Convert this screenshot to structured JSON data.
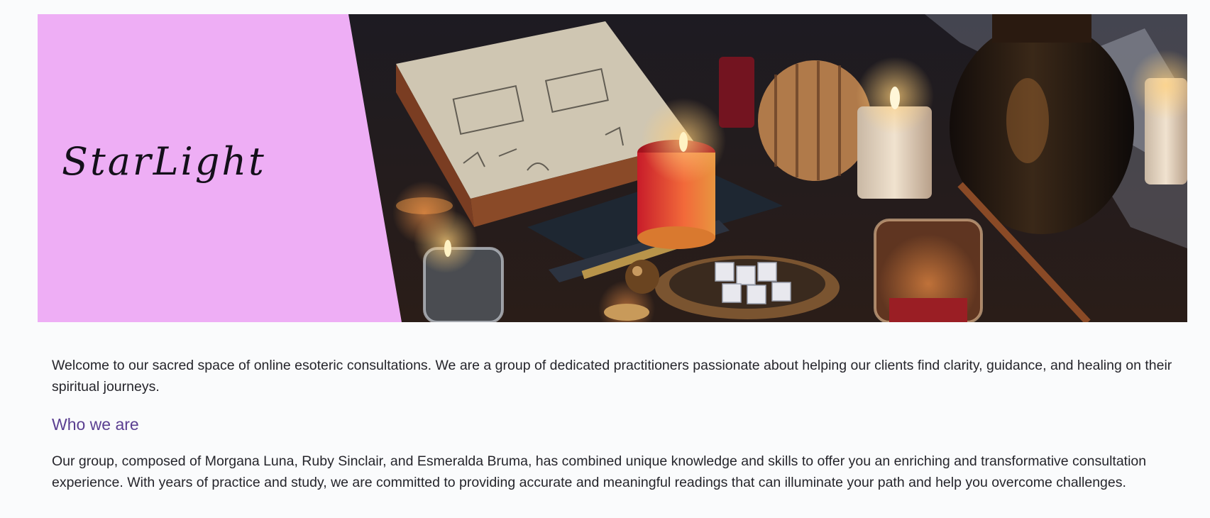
{
  "header": {
    "brand": "StarLight",
    "panel_color": "#eeaef5",
    "hero_image": "candle-altar-photo"
  },
  "main": {
    "intro": "Welcome to our sacred space of online esoteric consultations. We are a group of dedicated practitioners passionate about helping our clients find clarity, guidance, and healing on their spiritual journeys.",
    "who_heading": "Who we are",
    "who_text": "Our group, composed of Morgana Luna, Ruby Sinclair, and Esmeralda Bruma, has combined unique knowledge and skills to offer you an enriching and transformative consultation experience. With years of practice and study, we are committed to providing accurate and meaningful readings that can illuminate your path and help you overcome challenges."
  },
  "colors": {
    "heading": "#5b3f91",
    "text": "#25252b",
    "background": "#fafbfc"
  }
}
